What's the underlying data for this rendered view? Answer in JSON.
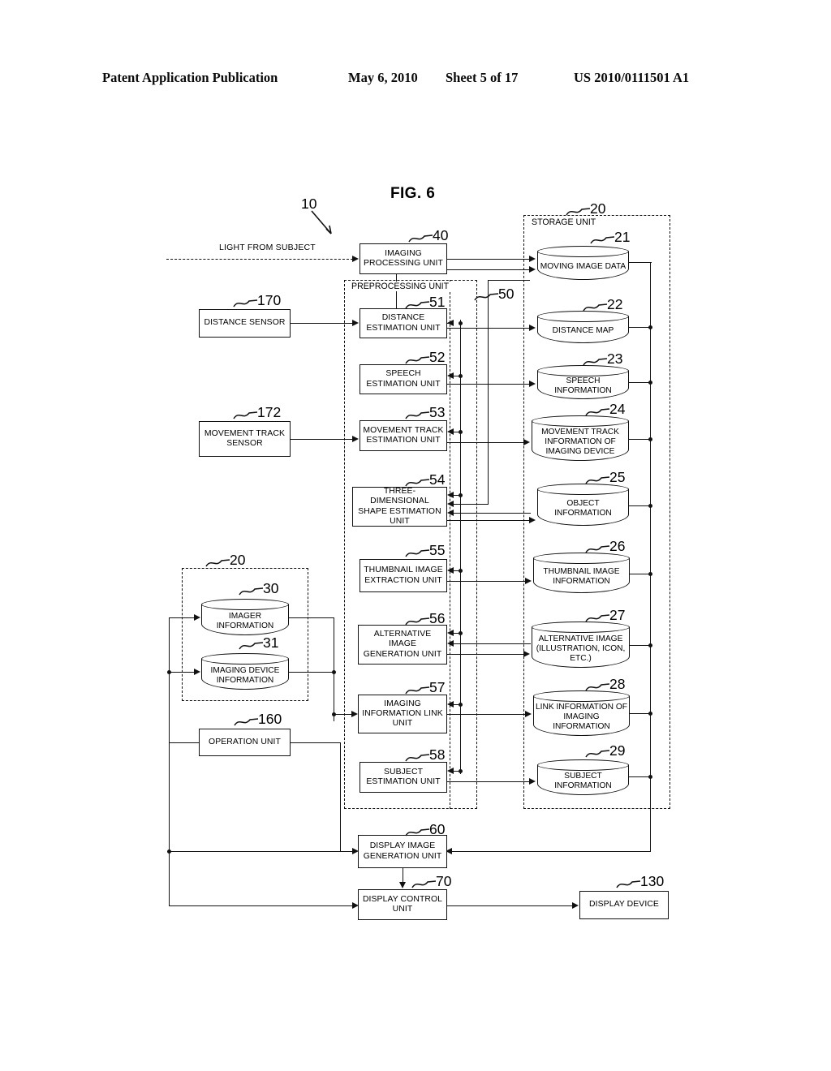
{
  "header": {
    "publication": "Patent Application Publication",
    "date": "May 6, 2010",
    "sheet": "Sheet 5 of 17",
    "patent_number": "US 2010/0111501 A1"
  },
  "figure": {
    "title": "FIG. 6"
  },
  "labels": {
    "light_from_subject": "LIGHT FROM SUBJECT",
    "storage_unit": "STORAGE UNIT",
    "preprocessing_unit": "PREPROCESSING UNIT"
  },
  "refs": {
    "r10": "10",
    "r20a": "20",
    "r20b": "20",
    "r21": "21",
    "r22": "22",
    "r23": "23",
    "r24": "24",
    "r25": "25",
    "r26": "26",
    "r27": "27",
    "r28": "28",
    "r29": "29",
    "r30": "30",
    "r31": "31",
    "r40": "40",
    "r50": "50",
    "r51": "51",
    "r52": "52",
    "r53": "53",
    "r54": "54",
    "r55": "55",
    "r56": "56",
    "r57": "57",
    "r58": "58",
    "r60": "60",
    "r70": "70",
    "r130": "130",
    "r160": "160",
    "r170": "170",
    "r172": "172"
  },
  "blocks": {
    "imaging_processing_unit": "IMAGING PROCESSING UNIT",
    "distance_sensor": "DISTANCE SENSOR",
    "movement_track_sensor": "MOVEMENT TRACK SENSOR",
    "distance_estimation_unit": "DISTANCE ESTIMATION UNIT",
    "speech_estimation_unit": "SPEECH ESTIMATION UNIT",
    "movement_track_estimation_unit": "MOVEMENT TRACK ESTIMATION UNIT",
    "three_dimensional_shape_estimation_unit": "THREE-DIMENSIONAL SHAPE ESTIMATION UNIT",
    "thumbnail_image_extraction_unit": "THUMBNAIL IMAGE EXTRACTION UNIT",
    "alternative_image_generation_unit": "ALTERNATIVE IMAGE GENERATION UNIT",
    "imaging_information_link_unit": "IMAGING INFORMATION LINK UNIT",
    "subject_estimation_unit": "SUBJECT ESTIMATION UNIT",
    "operation_unit": "OPERATION UNIT",
    "display_image_generation_unit": "DISPLAY IMAGE GENERATION UNIT",
    "display_control_unit": "DISPLAY CONTROL UNIT",
    "display_device": "DISPLAY DEVICE"
  },
  "stores": {
    "moving_image_data": "MOVING IMAGE DATA",
    "distance_map": "DISTANCE MAP",
    "speech_information": "SPEECH INFORMATION",
    "movement_track_information_of_imaging_device": "MOVEMENT TRACK INFORMATION OF IMAGING DEVICE",
    "object_information": "OBJECT INFORMATION",
    "thumbnail_image_information": "THUMBNAIL IMAGE INFORMATION",
    "alternative_image": "ALTERNATIVE IMAGE (ILLUSTRATION, ICON, ETC.)",
    "link_information_of_imaging_information": "LINK INFORMATION OF IMAGING INFORMATION",
    "subject_information": "SUBJECT INFORMATION",
    "imager_information": "IMAGER INFORMATION",
    "imaging_device_information": "IMAGING DEVICE INFORMATION"
  }
}
